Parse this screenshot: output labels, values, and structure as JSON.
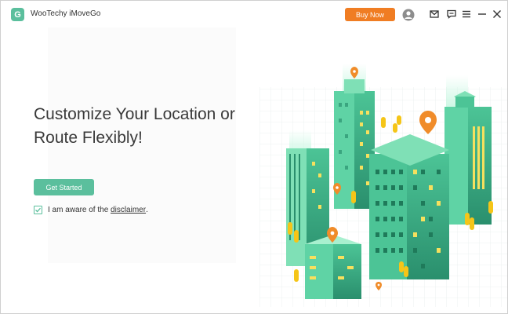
{
  "app": {
    "title": "WooTechy iMoveGo",
    "logo_letter": "G",
    "buy_label": "Buy Now"
  },
  "titlebar_icons": [
    "account-icon",
    "mail-icon",
    "feedback-icon",
    "menu-icon",
    "minimize-icon",
    "close-icon"
  ],
  "main": {
    "headline_line1": "Customize Your Location or",
    "headline_line2": "Route Flexibly!",
    "get_started_label": "Get Started",
    "aware_text": "I am aware of the",
    "disclaimer_link": "disclaimer",
    "aware_suffix": ".",
    "checkbox_checked": true
  },
  "colors": {
    "accent_green": "#5bbf9d",
    "buy_orange": "#f07d23",
    "pin_orange": "#f08c2a",
    "building_dark": "#2e9e7a",
    "building_light": "#7fe0b6",
    "window_yellow": "#f6e05e"
  }
}
